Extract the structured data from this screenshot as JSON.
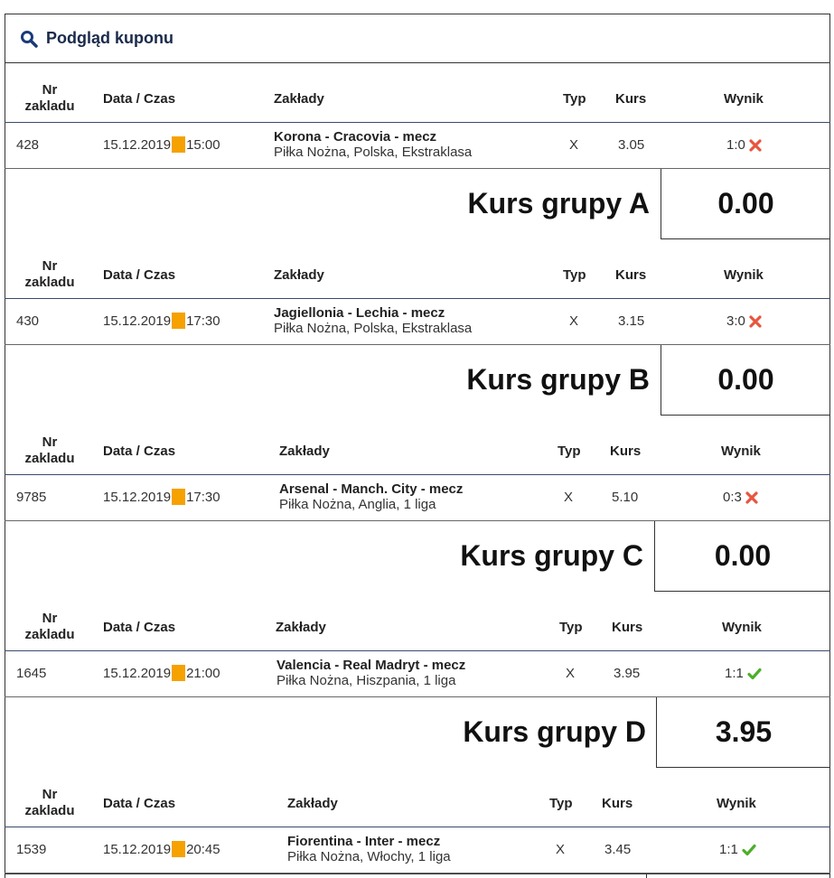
{
  "header": {
    "title": "Podgląd kuponu",
    "icon": "search-icon"
  },
  "columns": {
    "nr": "Nr zakladu",
    "date": "Data / Czas",
    "bets": "Zakłady",
    "type": "Typ",
    "odds": "Kurs",
    "result": "Wynik"
  },
  "groups": [
    {
      "bet": {
        "nr": "428",
        "date": "15.12.2019",
        "time": "15:00",
        "match": "Korona - Cracovia - mecz",
        "league": "Piłka Nożna, Polska, Ekstraklasa",
        "type": "X",
        "odds": "3.05",
        "score": "1:0",
        "outcome": "lost"
      },
      "total_label": "Kurs grupy A",
      "total_value": "0.00"
    },
    {
      "bet": {
        "nr": "430",
        "date": "15.12.2019",
        "time": "17:30",
        "match": "Jagiellonia - Lechia - mecz",
        "league": "Piłka Nożna, Polska, Ekstraklasa",
        "type": "X",
        "odds": "3.15",
        "score": "3:0",
        "outcome": "lost"
      },
      "total_label": "Kurs grupy B",
      "total_value": "0.00"
    },
    {
      "bet": {
        "nr": "9785",
        "date": "15.12.2019",
        "time": "17:30",
        "match": "Arsenal - Manch. City - mecz",
        "league": "Piłka Nożna, Anglia, 1 liga",
        "type": "X",
        "odds": "5.10",
        "score": "0:3",
        "outcome": "lost"
      },
      "total_label": "Kurs grupy C",
      "total_value": "0.00"
    },
    {
      "bet": {
        "nr": "1645",
        "date": "15.12.2019",
        "time": "21:00",
        "match": "Valencia - Real Madryt - mecz",
        "league": "Piłka Nożna, Hiszpania, 1 liga",
        "type": "X",
        "odds": "3.95",
        "score": "1:1",
        "outcome": "won"
      },
      "total_label": "Kurs grupy D",
      "total_value": "3.95"
    },
    {
      "bet": {
        "nr": "1539",
        "date": "15.12.2019",
        "time": "20:45",
        "match": "Fiorentina - Inter - mecz",
        "league": "Piłka Nożna, Włochy, 1 liga",
        "type": "X",
        "odds": "3.45",
        "score": "1:1",
        "outcome": "won"
      }
    }
  ],
  "colors": {
    "date_separator": "#f5a100",
    "lost": "#e8553e",
    "won": "#4caf2a",
    "header_text": "#1a2a4a"
  }
}
